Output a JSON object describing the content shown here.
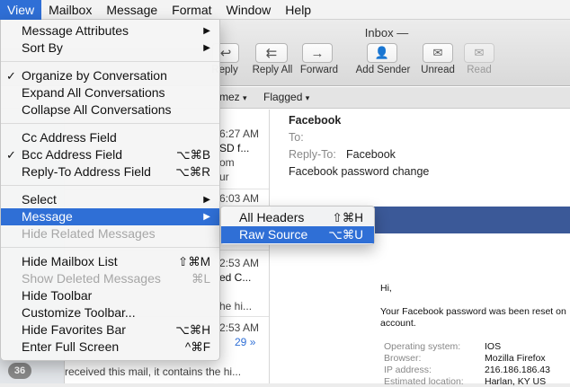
{
  "menubar": [
    "View",
    "Mailbox",
    "Message",
    "Format",
    "Window",
    "Help"
  ],
  "window": {
    "title": "Inbox —"
  },
  "toolbar": {
    "reply": "Reply",
    "reply_all": "Reply All",
    "forward": "Forward",
    "add_sender": "Add Sender",
    "unread": "Unread",
    "read": "Read"
  },
  "favbar": {
    "item1": "mez",
    "item2": "Flagged"
  },
  "list": {
    "rows": [
      {
        "time": "6:27 AM",
        "line2": "SD f...",
        "line3": "om",
        "line4": "ur"
      },
      {
        "time": "6:03 AM",
        "line2": "",
        "line3": "",
        "line4": ""
      },
      {
        "time": "2:53 AM",
        "line2": "ed C...",
        "line3": "he hi...",
        "line4": ""
      },
      {
        "time": "2:53 AM",
        "line2": "",
        "line3": "",
        "line4": ""
      }
    ],
    "thread_count": "29",
    "preview_last": "received this mail, it contains the hi...",
    "badge": "36"
  },
  "message": {
    "sender": "Facebook",
    "to_label": "To:",
    "replyto_label": "Reply-To:",
    "replyto_value": "Facebook",
    "subject": "Facebook password change",
    "greeting": "Hi,",
    "body1": "Your Facebook password was been reset on",
    "body2": "account.",
    "details": [
      {
        "label": "Operating system:",
        "value": "IOS"
      },
      {
        "label": "Browser:",
        "value": "Mozilla Firefox"
      },
      {
        "label": "IP address:",
        "value": "216.186.186.43"
      },
      {
        "label": "Estimated location:",
        "value": "Harlan, KY US"
      }
    ]
  },
  "menu": {
    "items": [
      {
        "label": "Message Attributes",
        "arrow": "▶"
      },
      {
        "label": "Sort By",
        "arrow": "▶"
      },
      {
        "label": "Organize by Conversation",
        "check": "✓"
      },
      {
        "label": "Expand All Conversations"
      },
      {
        "label": "Collapse All Conversations"
      },
      {
        "label": "Cc Address Field"
      },
      {
        "label": "Bcc Address Field",
        "check": "✓",
        "shortcut": "⌥⌘B"
      },
      {
        "label": "Reply-To Address Field",
        "shortcut": "⌥⌘R"
      },
      {
        "label": "Select",
        "arrow": "▶"
      },
      {
        "label": "Message",
        "arrow": "▶"
      },
      {
        "label": "Hide Related Messages"
      },
      {
        "label": "Hide Mailbox List",
        "shortcut": "⇧⌘M"
      },
      {
        "label": "Show Deleted Messages",
        "shortcut": "⌘L"
      },
      {
        "label": "Hide Toolbar"
      },
      {
        "label": "Customize Toolbar..."
      },
      {
        "label": "Hide Favorites Bar",
        "shortcut": "⌥⌘H"
      },
      {
        "label": "Enter Full Screen",
        "shortcut": "^⌘F"
      }
    ]
  },
  "submenu": {
    "items": [
      {
        "label": "All Headers",
        "shortcut": "⇧⌘H"
      },
      {
        "label": "Raw Source",
        "shortcut": "⌥⌘U"
      }
    ]
  },
  "colors": {
    "highlight": "#2f6fd6",
    "facebook": "#3b5998",
    "thread_count": "#2f6fd6"
  }
}
